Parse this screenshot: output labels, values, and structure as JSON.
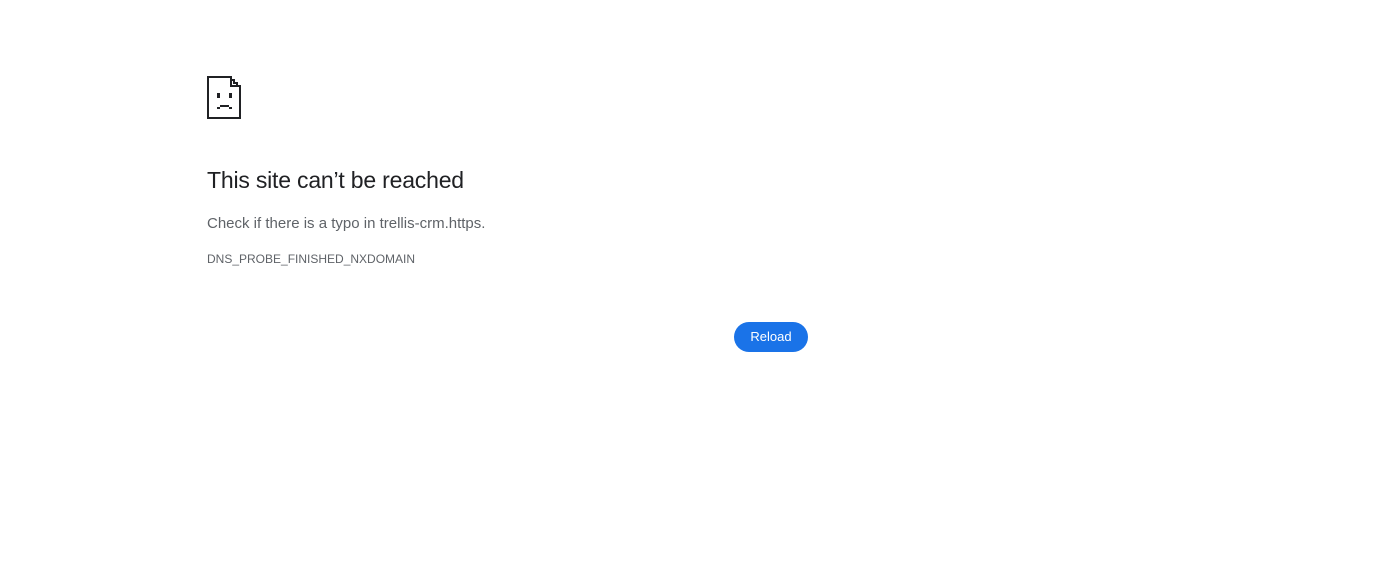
{
  "error": {
    "icon": "sad-page-icon",
    "title": "This site can’t be reached",
    "message": "Check if there is a typo in trellis-crm.https.",
    "code": "DNS_PROBE_FINISHED_NXDOMAIN"
  },
  "actions": {
    "reload_label": "Reload"
  },
  "colors": {
    "accent": "#1a73e8",
    "title_text": "#202124",
    "secondary_text": "#5f6368",
    "background": "#ffffff"
  }
}
